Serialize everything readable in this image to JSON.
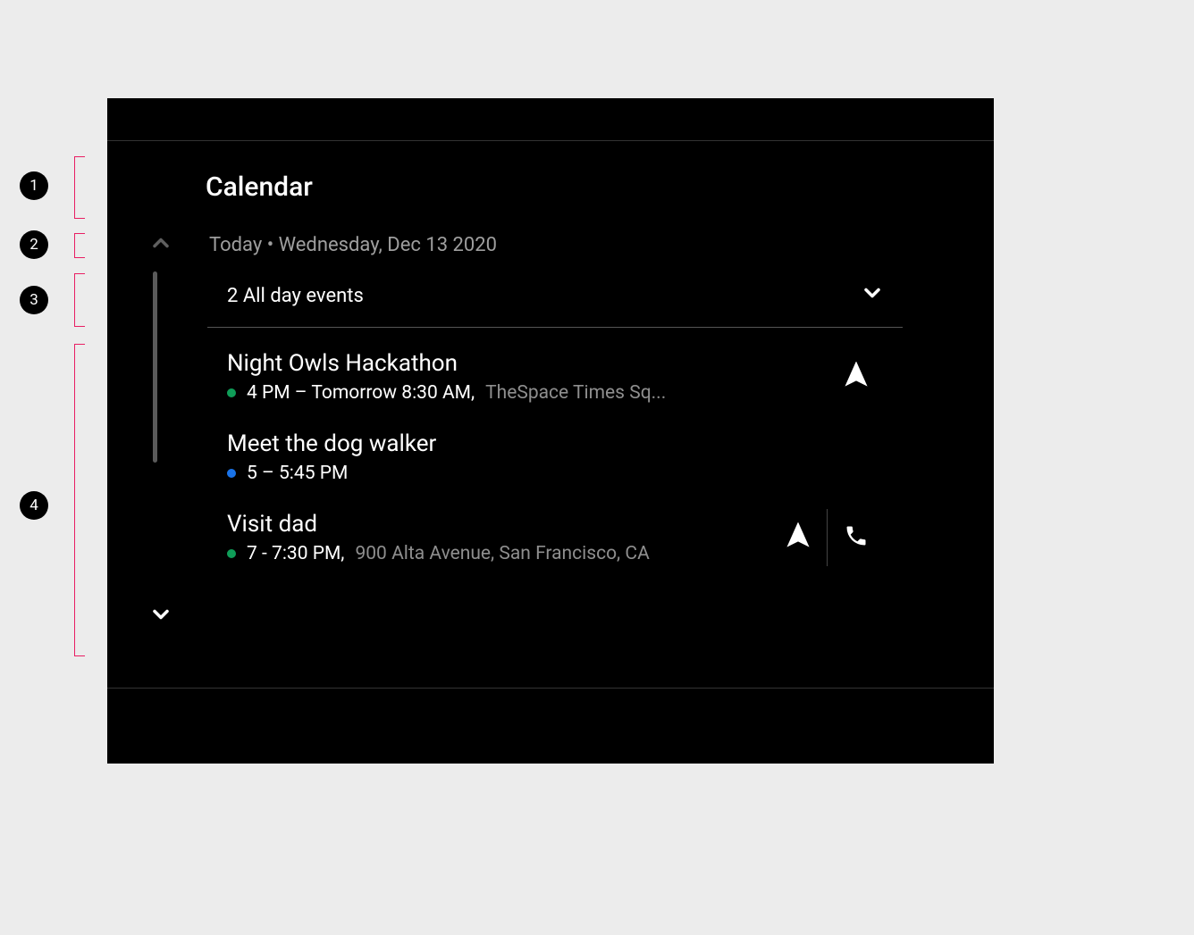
{
  "app": {
    "title": "Calendar"
  },
  "date_line": "Today • Wednesday, Dec 13 2020",
  "all_day": {
    "label": "2 All day events"
  },
  "events": [
    {
      "title": "Night Owls Hackathon",
      "time": "4 PM – Tomorrow 8:30 AM,",
      "location": "TheSpace Times Sq...",
      "dot_color": "#0f9d58",
      "has_navigate": true,
      "has_call": false
    },
    {
      "title": "Meet the dog walker",
      "time": "5 – 5:45 PM",
      "location": "",
      "dot_color": "#1a73e8",
      "has_navigate": false,
      "has_call": false
    },
    {
      "title": "Visit dad",
      "time": "7 - 7:30 PM,",
      "location": "900 Alta Avenue, San Francisco, CA",
      "dot_color": "#0f9d58",
      "has_navigate": true,
      "has_call": true
    }
  ],
  "annotations": [
    "1",
    "2",
    "3",
    "4"
  ]
}
